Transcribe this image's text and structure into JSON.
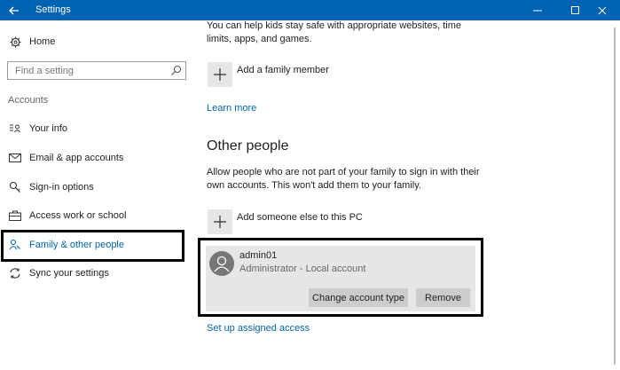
{
  "window": {
    "title": "Settings",
    "back_icon": "arrow-left-icon",
    "controls": [
      "minimize-icon",
      "maximize-icon",
      "close-icon"
    ]
  },
  "sidebar": {
    "home_label": "Home",
    "search_placeholder": "Find a setting",
    "section_header": "Accounts",
    "items": [
      {
        "label": "Your info",
        "icon": "person-card-icon"
      },
      {
        "label": "Email & app accounts",
        "icon": "mail-icon"
      },
      {
        "label": "Sign-in options",
        "icon": "key-icon"
      },
      {
        "label": "Access work or school",
        "icon": "briefcase-icon"
      },
      {
        "label": "Family & other people",
        "icon": "people-icon",
        "selected": true
      },
      {
        "label": "Sync your settings",
        "icon": "sync-icon"
      }
    ]
  },
  "main": {
    "family_intro": "You can help kids stay safe with appropriate websites, time limits, apps, and games.",
    "add_family_label": "Add a family member",
    "learn_more": "Learn more",
    "other_people_heading": "Other people",
    "other_people_desc": "Allow people who are not part of your family to sign in with their own accounts. This won't add them to your family.",
    "add_someone_label": "Add someone else to this PC",
    "account": {
      "name": "admin01",
      "type": "Administrator - Local account",
      "change_type_label": "Change account type",
      "remove_label": "Remove"
    },
    "assigned_access_link": "Set up assigned access"
  },
  "colors": {
    "accent": "#0063b1",
    "titlebar": "#0063b1",
    "panel": "#e6e6e6",
    "button": "#cccccc"
  }
}
